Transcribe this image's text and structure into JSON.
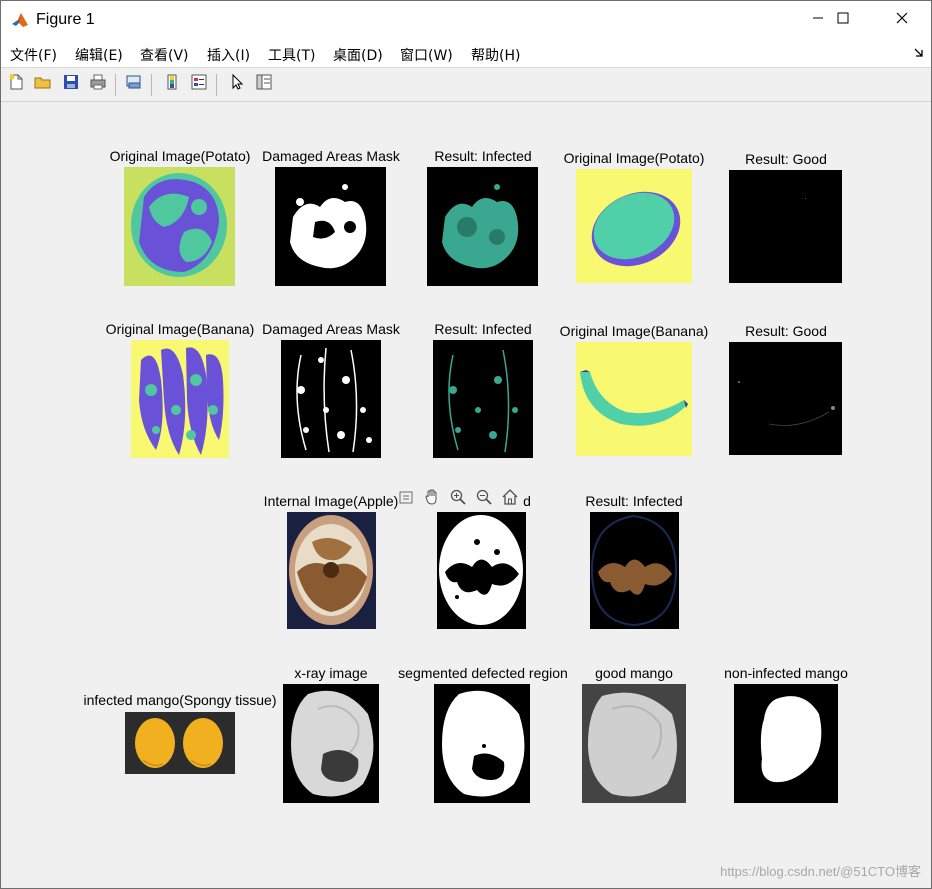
{
  "window": {
    "title": "Figure 1",
    "minimize_icon": "minimize-icon",
    "maximize_icon": "maximize-icon",
    "close_icon": "close-icon"
  },
  "menu": {
    "items": [
      {
        "label": "文件(F)"
      },
      {
        "label": "编辑(E)"
      },
      {
        "label": "查看(V)"
      },
      {
        "label": "插入(I)"
      },
      {
        "label": "工具(T)"
      },
      {
        "label": "桌面(D)"
      },
      {
        "label": "窗口(W)"
      },
      {
        "label": "帮助(H)"
      }
    ]
  },
  "toolbar": {
    "icons": [
      "new-figure-icon",
      "open-file-icon",
      "save-icon",
      "print-icon",
      "link-plot-icon",
      "insert-colorbar-icon",
      "insert-legend-icon",
      "edit-plot-pointer-icon",
      "property-inspector-icon"
    ]
  },
  "axes_toolbar": {
    "icons": [
      "export-icon",
      "pan-hand-icon",
      "zoom-in-icon",
      "zoom-out-icon",
      "restore-view-home-icon"
    ]
  },
  "subplots": {
    "row1": [
      {
        "label": "Original Image(Potato)"
      },
      {
        "label": "Damaged Areas Mask"
      },
      {
        "label": "Result: Infected"
      },
      {
        "label": "Original Image(Potato)"
      },
      {
        "label": "Result: Good"
      }
    ],
    "row2": [
      {
        "label": "Original Image(Banana)"
      },
      {
        "label": "Damaged Areas Mask"
      },
      {
        "label": "Result: Infected"
      },
      {
        "label": "Original Image(Banana)"
      },
      {
        "label": "Result: Good"
      }
    ],
    "row3": [
      {
        "label": "Internal Image(Apple)"
      },
      {
        "label": "d"
      },
      {
        "label": "Result: Infected"
      }
    ],
    "row4": [
      {
        "label": "infected mango(Spongy tissue)"
      },
      {
        "label": "x-ray image"
      },
      {
        "label": "segmented defected region"
      },
      {
        "label": "good mango"
      },
      {
        "label": "non-infected mango"
      }
    ]
  },
  "watermark": "https://blog.csdn.net/@51CTO博客",
  "colors": {
    "titlebar_bg": "#ffffff",
    "canvas_bg": "#f0f0f0",
    "mask_bg": "#000000",
    "yellow_bg": "#f9f871",
    "teal": "#4ccfa0",
    "purple": "#6a4fcf"
  }
}
